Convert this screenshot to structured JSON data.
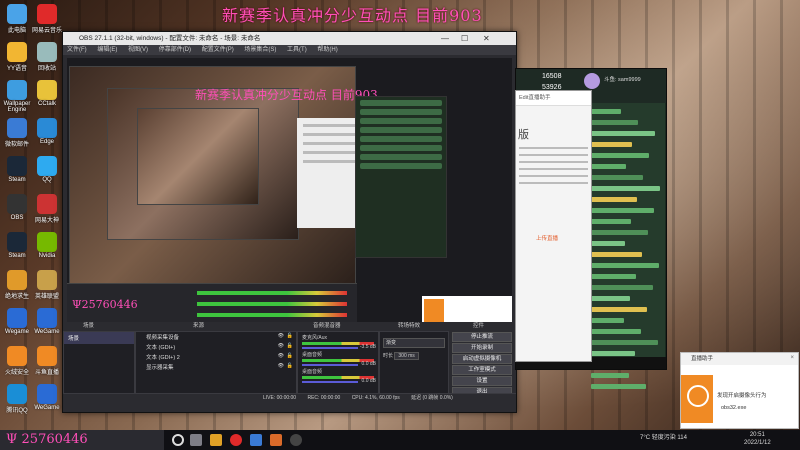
{
  "overlay_title": "新赛季认真冲分少互动点 目前903",
  "overlay_small": "新赛季认真冲分少互动点 目前903",
  "pink_id": "Ψ25760446",
  "desktop_icons": [
    "此电脑",
    "网易云音乐",
    "YY语音",
    "回收站",
    "Wallpaper Engine",
    "CCtalk",
    "微软邮件",
    "Edge",
    "Steam",
    "QQ",
    "OBS",
    "网易大神",
    "Steam",
    "Nvidia",
    "绝地求生",
    "英雄联盟",
    "Wegame",
    "WeGame",
    "火绒安全",
    "斗鱼直播",
    "腾讯QQ",
    "WeGame"
  ],
  "obs": {
    "title": "OBS 27.1.1 (32-bit, windows) - 配置文件: 未命名 - 场景: 未命名",
    "menu": [
      "文件(F)",
      "编辑(E)",
      "视图(V)",
      "停靠部件(D)",
      "配置文件(P)",
      "场景集合(S)",
      "工具(T)",
      "帮助(H)"
    ],
    "docks": {
      "scenes": "场景",
      "sources": "来源",
      "mixer": "音频混音器",
      "transitions": "转场特效",
      "controls": "控件"
    },
    "scene_items": [
      "场景"
    ],
    "sources": [
      "视频采集设备",
      "文本 (GDI+)",
      "文本 (GDI+) 2",
      "显示器采集"
    ],
    "mixer": [
      {
        "label": "麦克风/Aux",
        "value": "-3.5 dB"
      },
      {
        "label": "桌面音频",
        "value": "0.0 dB"
      },
      {
        "label": "桌面音频",
        "value": "0.0 dB"
      }
    ],
    "transition": {
      "select": "渐变",
      "duration_label": "时长",
      "duration": "300 ms"
    },
    "controls": [
      "停止推流",
      "开始录制",
      "启动虚拟摄像机",
      "工作室模式",
      "设置",
      "退出"
    ],
    "status": [
      "LIVE: 00:00:00",
      "REC: 00:00:00",
      "CPU: 4.1%, 60.00 fps",
      "延迟 (0 跳帧 0.0%)"
    ],
    "preview_tabs": [
      "滤镜",
      "属性"
    ]
  },
  "chat": {
    "count1": "16508",
    "count2": "53926",
    "user": "斗鱼: sam9999",
    "sidebar_label": "直播间"
  },
  "white_win": {
    "header": "Edit直播助手",
    "big_char": "版",
    "link": "上传直播"
  },
  "toast": {
    "header": "直播助手",
    "line1": "发现开启摄像头行为",
    "line2": "obs32.exe",
    "close": "×"
  },
  "taskbar": {
    "search_text": "Ψ 25760446",
    "weather": "7°C 轻度污染 114",
    "time": "20:51",
    "date": "2022/1/12"
  },
  "colors": {
    "overlay": "#ff4fb8",
    "obs_bg": "#2b2b30",
    "accent": "#f08a24",
    "chat_bg": "#253b2c"
  }
}
